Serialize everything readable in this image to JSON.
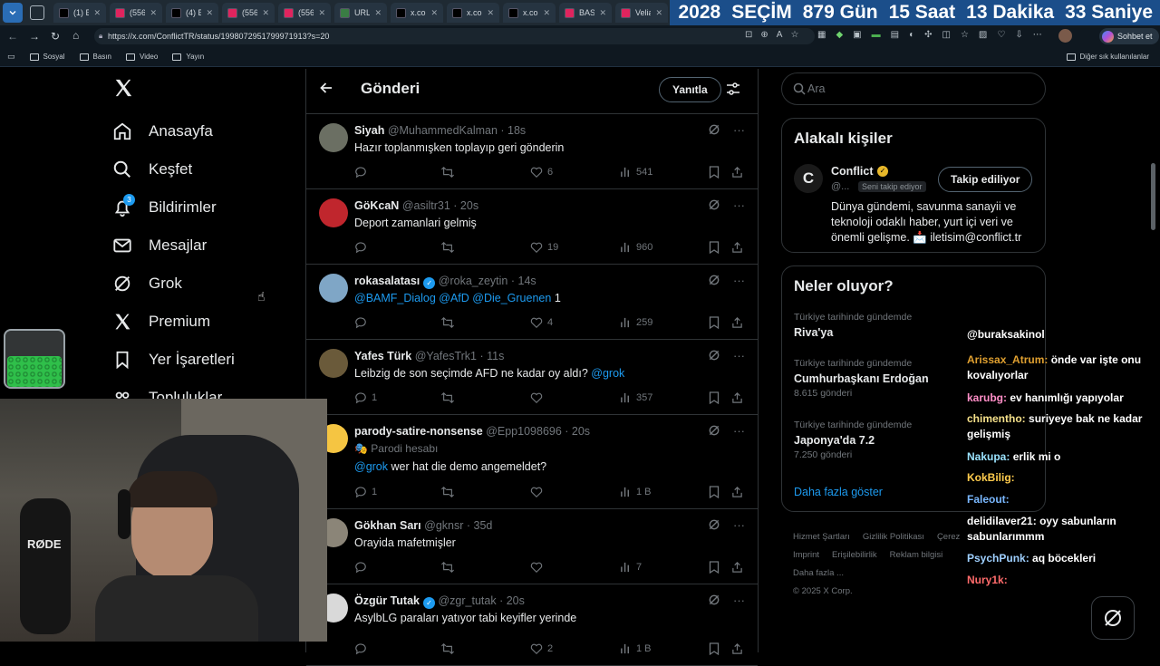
{
  "browser": {
    "tabs": [
      {
        "label": "(1) Eng",
        "color": "#000000"
      },
      {
        "label": "(556) In",
        "color": "#e0245e"
      },
      {
        "label": "(4) Bild",
        "color": "#000000"
      },
      {
        "label": "(556) S",
        "color": "#e0245e"
      },
      {
        "label": "(556) S",
        "color": "#e0245e"
      },
      {
        "label": "URL Ne",
        "color": "#3a7d44"
      },
      {
        "label": "x.com/",
        "color": "#000000"
      },
      {
        "label": "x.com/",
        "color": "#000000"
      },
      {
        "label": "x.com/",
        "color": "#000000"
      },
      {
        "label": "BASHA",
        "color": "#e0245e"
      },
      {
        "label": "Veliaht",
        "color": "#e0245e"
      }
    ],
    "countdown": {
      "year": "2028",
      "title": "SEÇİM",
      "days": "879 Gün",
      "hours": "15 Saat",
      "minutes": "13 Dakika",
      "seconds": "33 Saniye"
    },
    "url": "https://x.com/ConflictTR/status/1998072951799971913?s=20",
    "chat_button": "Sohbet et",
    "bookmarks": [
      "Sosyal",
      "Basın",
      "Video",
      "Yayın"
    ],
    "other_bookmarks": "Diğer sık kullanılanlar"
  },
  "nav": {
    "items": [
      {
        "label": "Anasayfa",
        "icon": "home-icon"
      },
      {
        "label": "Keşfet",
        "icon": "search-icon"
      },
      {
        "label": "Bildirimler",
        "icon": "bell-icon",
        "badge": "3"
      },
      {
        "label": "Mesajlar",
        "icon": "mail-icon"
      },
      {
        "label": "Grok",
        "icon": "grok-icon"
      },
      {
        "label": "Premium",
        "icon": "x-logo-icon"
      },
      {
        "label": "Yer İşaretleri",
        "icon": "bookmark-icon"
      },
      {
        "label": "Topluluklar",
        "icon": "communities-icon"
      }
    ]
  },
  "header": {
    "title": "Gönderi",
    "reply_button": "Yanıtla"
  },
  "tweets": [
    {
      "name": "Siyah",
      "handle": "@MuhammedKalman",
      "time": "18s",
      "text": "Hazır toplanmışken toplayıp geri gönderin",
      "replies": "",
      "likes": "6",
      "views": "541",
      "avatar_color": "#6b6f63"
    },
    {
      "name": "GöKcaN",
      "handle": "@asiltr31",
      "time": "20s",
      "text": "Deport zamanlari gelmiş",
      "replies": "",
      "likes": "19",
      "views": "960",
      "avatar_color": "#c0262d"
    },
    {
      "name": "rokasalatası",
      "handle": "@roka_zeytin",
      "time": "14s",
      "verified": true,
      "mentions": "@BAMF_Dialog @AfD @Die_Gruenen",
      "text": "1",
      "replies": "",
      "likes": "4",
      "views": "259",
      "avatar_color": "#7fa6c6"
    },
    {
      "name": "Yafes Türk",
      "handle": "@YafesTrk1",
      "time": "11s",
      "text": "Leibzig de son seçimde AFD  ne kadar oy aldı?",
      "mention_after": "@grok",
      "replies": "1",
      "likes": "",
      "views": "357",
      "avatar_color": "#6a5a3a"
    },
    {
      "name": "parody-satire-nonsense",
      "handle": "@Epp1098696",
      "time": "20s",
      "parody": "Parodi hesabı",
      "mentions": "@grok",
      "text": "wer hat die demo angemeldet?",
      "replies": "1",
      "likes": "",
      "views": "1 B",
      "avatar_color": "#f5c542"
    },
    {
      "name": "Gökhan Sarı",
      "handle": "@gknsr",
      "time": "35d",
      "text": "Orayida mafetmişler",
      "replies": "",
      "likes": "",
      "views": "7",
      "avatar_color": "#8b8578"
    },
    {
      "name": "Özgür Tutak",
      "handle": "@zgr_tutak",
      "time": "20s",
      "verified": true,
      "text": "AsylbLG paraları yatıyor tabi keyifler yerinde",
      "replies": "",
      "likes": "2",
      "views": "1 B",
      "avatar_color": "#d9d9d9"
    }
  ],
  "search": {
    "placeholder": "Ara"
  },
  "related": {
    "title": "Alakalı kişiler",
    "name": "Conflict",
    "handle": "@...",
    "follows_you": "Seni takip ediyor",
    "follow_button": "Takip ediliyor",
    "bio": "Dünya gündemi, savunma sanayii ve teknoloji odaklı haber, yurt içi veri ve önemli gelişme. 📩 iletisim@conflict.tr"
  },
  "trends": {
    "title": "Neler oluyor?",
    "items": [
      {
        "meta": "Türkiye tarihinde gündemde",
        "name": "Riva'ya",
        "count": ""
      },
      {
        "meta": "Türkiye tarihinde gündemde",
        "name": "Cumhurbaşkanı Erdoğan",
        "count": "8.615 gönderi"
      },
      {
        "meta": "Türkiye tarihinde gündemde",
        "name": "Japonya'da 7.2",
        "count": "7.250 gönderi"
      }
    ],
    "show_more": "Daha fazla göster"
  },
  "footer": {
    "links": [
      "Hizmet Şartları",
      "Gizlilik Politikası",
      "Çerez",
      "Imprint",
      "Erişilebilirlik",
      "Reklam bilgisi",
      "Daha fazla ..."
    ],
    "copyright": "© 2025 X Corp."
  },
  "chat": [
    {
      "user": "@buraksakinol",
      "msg": "",
      "color": "#ffffff"
    },
    {
      "user": "Arissax_Atrum:",
      "msg": "önde var işte onu kovalıyorlar",
      "color": "#e0a030"
    },
    {
      "user": "karubg:",
      "msg": "ev hanımlığı yapıyolar",
      "color": "#ff8fc8"
    },
    {
      "user": "chimentho:",
      "msg": "suriyeye bak ne kadar gelişmiş",
      "color": "#f5e08a"
    },
    {
      "user": "Nakupa:",
      "msg": "erlik mi o",
      "color": "#9be3ff"
    },
    {
      "user": "KokBilig:",
      "msg": "",
      "color": "#ffcc4d"
    },
    {
      "user": "Faleout:",
      "msg": "",
      "color": "#7ab8ff"
    },
    {
      "user": "delidilaver21:",
      "msg": "oyy sabunların sabunlarımmm",
      "color": "#ffffff"
    },
    {
      "user": "PsychPunk:",
      "msg": "aq böcekleri",
      "color": "#9fd0ff"
    },
    {
      "user": "Nury1k:",
      "msg": "",
      "color": "#ff6b6b"
    }
  ],
  "overlay": {
    "webcam_brand": "RØDE"
  }
}
